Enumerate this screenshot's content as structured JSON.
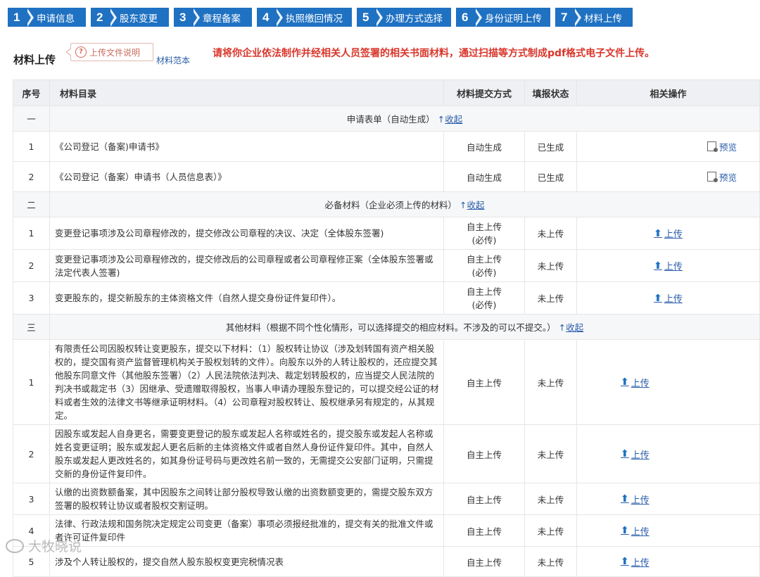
{
  "steps": [
    {
      "num": "1",
      "label": "申请信息"
    },
    {
      "num": "2",
      "label": "股东变更"
    },
    {
      "num": "3",
      "label": "章程备案"
    },
    {
      "num": "4",
      "label": "执照缴回情况"
    },
    {
      "num": "5",
      "label": "办理方式选择"
    },
    {
      "num": "6",
      "label": "身份证明上传"
    },
    {
      "num": "7",
      "label": "材料上传"
    }
  ],
  "header": {
    "title": "材料上传",
    "help_label": "上传文件说明",
    "help_icon": "question-circle-icon",
    "sample_link": "材料范本",
    "notice": "请将你企业依法制作并经相关人员签署的相关书面材料，通过扫描等方式制成pdf格式电子文件上传。"
  },
  "table": {
    "headers": [
      "序号",
      "材料目录",
      "材料提交方式",
      "填报状态",
      "相关操作"
    ],
    "sections": [
      {
        "no": "一",
        "title": "申请表单（自动生成）",
        "toggle_arrow": "↑",
        "toggle": "收起",
        "rows": [
          {
            "no": "1",
            "name": "《公司登记（备案)申请书》",
            "method": "自动生成",
            "status": "已生成",
            "action": "预览",
            "action_icon": "preview-icon"
          },
          {
            "no": "2",
            "name": "《公司登记（备案）申请书（人员信息表）》",
            "method": "自动生成",
            "status": "已生成",
            "action": "预览",
            "action_icon": "preview-icon"
          }
        ]
      },
      {
        "no": "二",
        "title": "必备材料（企业必须上传的材料）",
        "toggle_arrow": "↑",
        "toggle": "收起",
        "rows": [
          {
            "no": "1",
            "name": "变更登记事项涉及公司章程修改的，提交修改公司章程的决议、决定（全体股东签署)",
            "method": "自主上传",
            "method_note": "(必传)",
            "status": "未上传",
            "action": "上传",
            "action_icon": "upload-arrow-icon"
          },
          {
            "no": "2",
            "name": "变更登记事项涉及公司章程修改的，提交修改后的公司章程或者公司章程修正案（全体股东签署或法定代表人签署)",
            "method": "自主上传",
            "method_note": "(必传)",
            "status": "未上传",
            "action": "上传",
            "action_icon": "upload-arrow-icon"
          },
          {
            "no": "3",
            "name": "变更股东的，提交新股东的主体资格文件（自然人提交身份证件复印件）。",
            "method": "自主上传",
            "method_note": "(必传)",
            "status": "未上传",
            "action": "上传",
            "action_icon": "upload-arrow-icon"
          }
        ]
      },
      {
        "no": "三",
        "title": "其他材料（根据不同个性化情形，可以选择提交的相应材料。不涉及的可以不提交。）",
        "toggle_arrow": "↑",
        "toggle": "收起",
        "rows": [
          {
            "no": "1",
            "name": "有限责任公司因股权转让变更股东，提交以下材料：（1）股权转让协议（涉及划转国有资产相关股权的，提交国有资产监督管理机构关于股权划转的文件）。向股东以外的人转让股权的，还应提交其他股东同意文件（其他股东签署）（2）人民法院依法判决、裁定划转股权的，应当提交人民法院的判决书或裁定书（3）因继承、受遗赠取得股权，当事人申请办理股东登记的，可以提交经公证的材料或者生效的法律文书等继承证明材料。（4）公司章程对股权转让、股权继承另有规定的，从其规定。",
            "method": "自主上传",
            "status": "未上传",
            "action": "上传",
            "action_icon": "upload-arrow-icon"
          },
          {
            "no": "2",
            "name": "因股东或发起人自身更名，需要变更登记的股东或发起人名称或姓名的，提交股东或发起人名称或姓名变更证明；股东或发起人更名后新的主体资格文件或者自然人身份证件复印件。其中，自然人股东或发起人更改姓名的，如其身份证号码与更改姓名前一致的，无需提交公安部门证明，只需提交新的身份证件复印件。",
            "method": "自主上传",
            "status": "未上传",
            "action": "上传",
            "action_icon": "upload-arrow-icon"
          },
          {
            "no": "3",
            "name": "认缴的出资数额备案，其中因股东之间转让部分股权导致认缴的出资数额变更的，需提交股东双方签署的股权转让协议或者股权交割证明。",
            "method": "自主上传",
            "status": "未上传",
            "action": "上传",
            "action_icon": "upload-arrow-icon"
          },
          {
            "no": "4",
            "name": "法律、行政法规和国务院决定规定公司变更（备案）事项必须报经批准的，提交有关的批准文件或者许可证件复印件",
            "method": "自主上传",
            "status": "未上传",
            "action": "上传",
            "action_icon": "upload-arrow-icon"
          },
          {
            "no": "5",
            "name": "涉及个人转让股权的，提交自然人股东股权变更完税情况表",
            "method": "自主上传",
            "status": "未上传",
            "action": "上传",
            "action_icon": "upload-arrow-icon"
          }
        ]
      }
    ]
  },
  "watermark": "大牧晓说",
  "colors": {
    "step_bg": "#1f71c2",
    "notice": "#d9352a",
    "link": "#2a5caa",
    "header_bg": "#eef0f3"
  }
}
